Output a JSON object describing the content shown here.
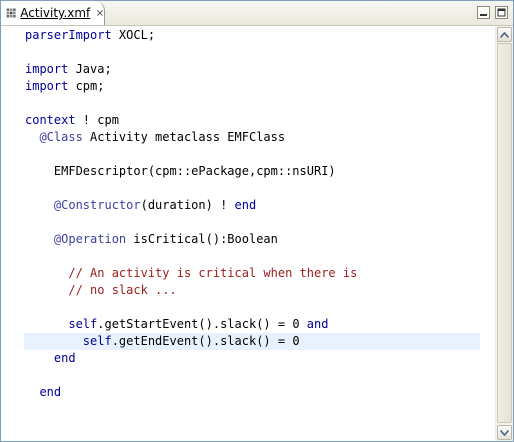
{
  "tab": {
    "title": "Activity.xmf",
    "icon": "xmf-file-icon"
  },
  "code_lines": [
    [
      {
        "t": "parserImport",
        "c": "kw"
      },
      {
        "t": " XOCL;",
        "c": ""
      }
    ],
    [],
    [
      {
        "t": "import",
        "c": "kw"
      },
      {
        "t": " Java;",
        "c": ""
      }
    ],
    [
      {
        "t": "import",
        "c": "kw"
      },
      {
        "t": " cpm;",
        "c": ""
      }
    ],
    [],
    [
      {
        "t": "context",
        "c": "kw"
      },
      {
        "t": " ! cpm",
        "c": ""
      }
    ],
    [
      {
        "t": "  ",
        "c": ""
      },
      {
        "t": "@Class",
        "c": "ann"
      },
      {
        "t": " Activity metaclass EMFClass",
        "c": ""
      }
    ],
    [],
    [
      {
        "t": "    EMFDescriptor(cpm::ePackage,cpm::nsURI)",
        "c": ""
      }
    ],
    [],
    [
      {
        "t": "    ",
        "c": ""
      },
      {
        "t": "@Constructor",
        "c": "ann"
      },
      {
        "t": "(duration) ! ",
        "c": ""
      },
      {
        "t": "end",
        "c": "kw"
      }
    ],
    [],
    [
      {
        "t": "    ",
        "c": ""
      },
      {
        "t": "@Operation",
        "c": "ann"
      },
      {
        "t": " isCritical():Boolean",
        "c": ""
      }
    ],
    [],
    [
      {
        "t": "      // An activity is critical when there is",
        "c": "cmt"
      }
    ],
    [
      {
        "t": "      // no slack ...",
        "c": "cmt"
      }
    ],
    [],
    [
      {
        "t": "      ",
        "c": ""
      },
      {
        "t": "self",
        "c": "kw"
      },
      {
        "t": ".getStartEvent().slack() = 0 ",
        "c": ""
      },
      {
        "t": "and",
        "c": "kw"
      }
    ],
    [
      {
        "t": "        ",
        "c": ""
      },
      {
        "t": "self",
        "c": "kw"
      },
      {
        "t": ".getEndEvent().slack() = 0",
        "c": ""
      }
    ],
    [
      {
        "t": "    ",
        "c": ""
      },
      {
        "t": "end",
        "c": "kw"
      }
    ],
    [],
    [
      {
        "t": "  ",
        "c": ""
      },
      {
        "t": "end",
        "c": "kw"
      }
    ]
  ],
  "current_line": 18
}
